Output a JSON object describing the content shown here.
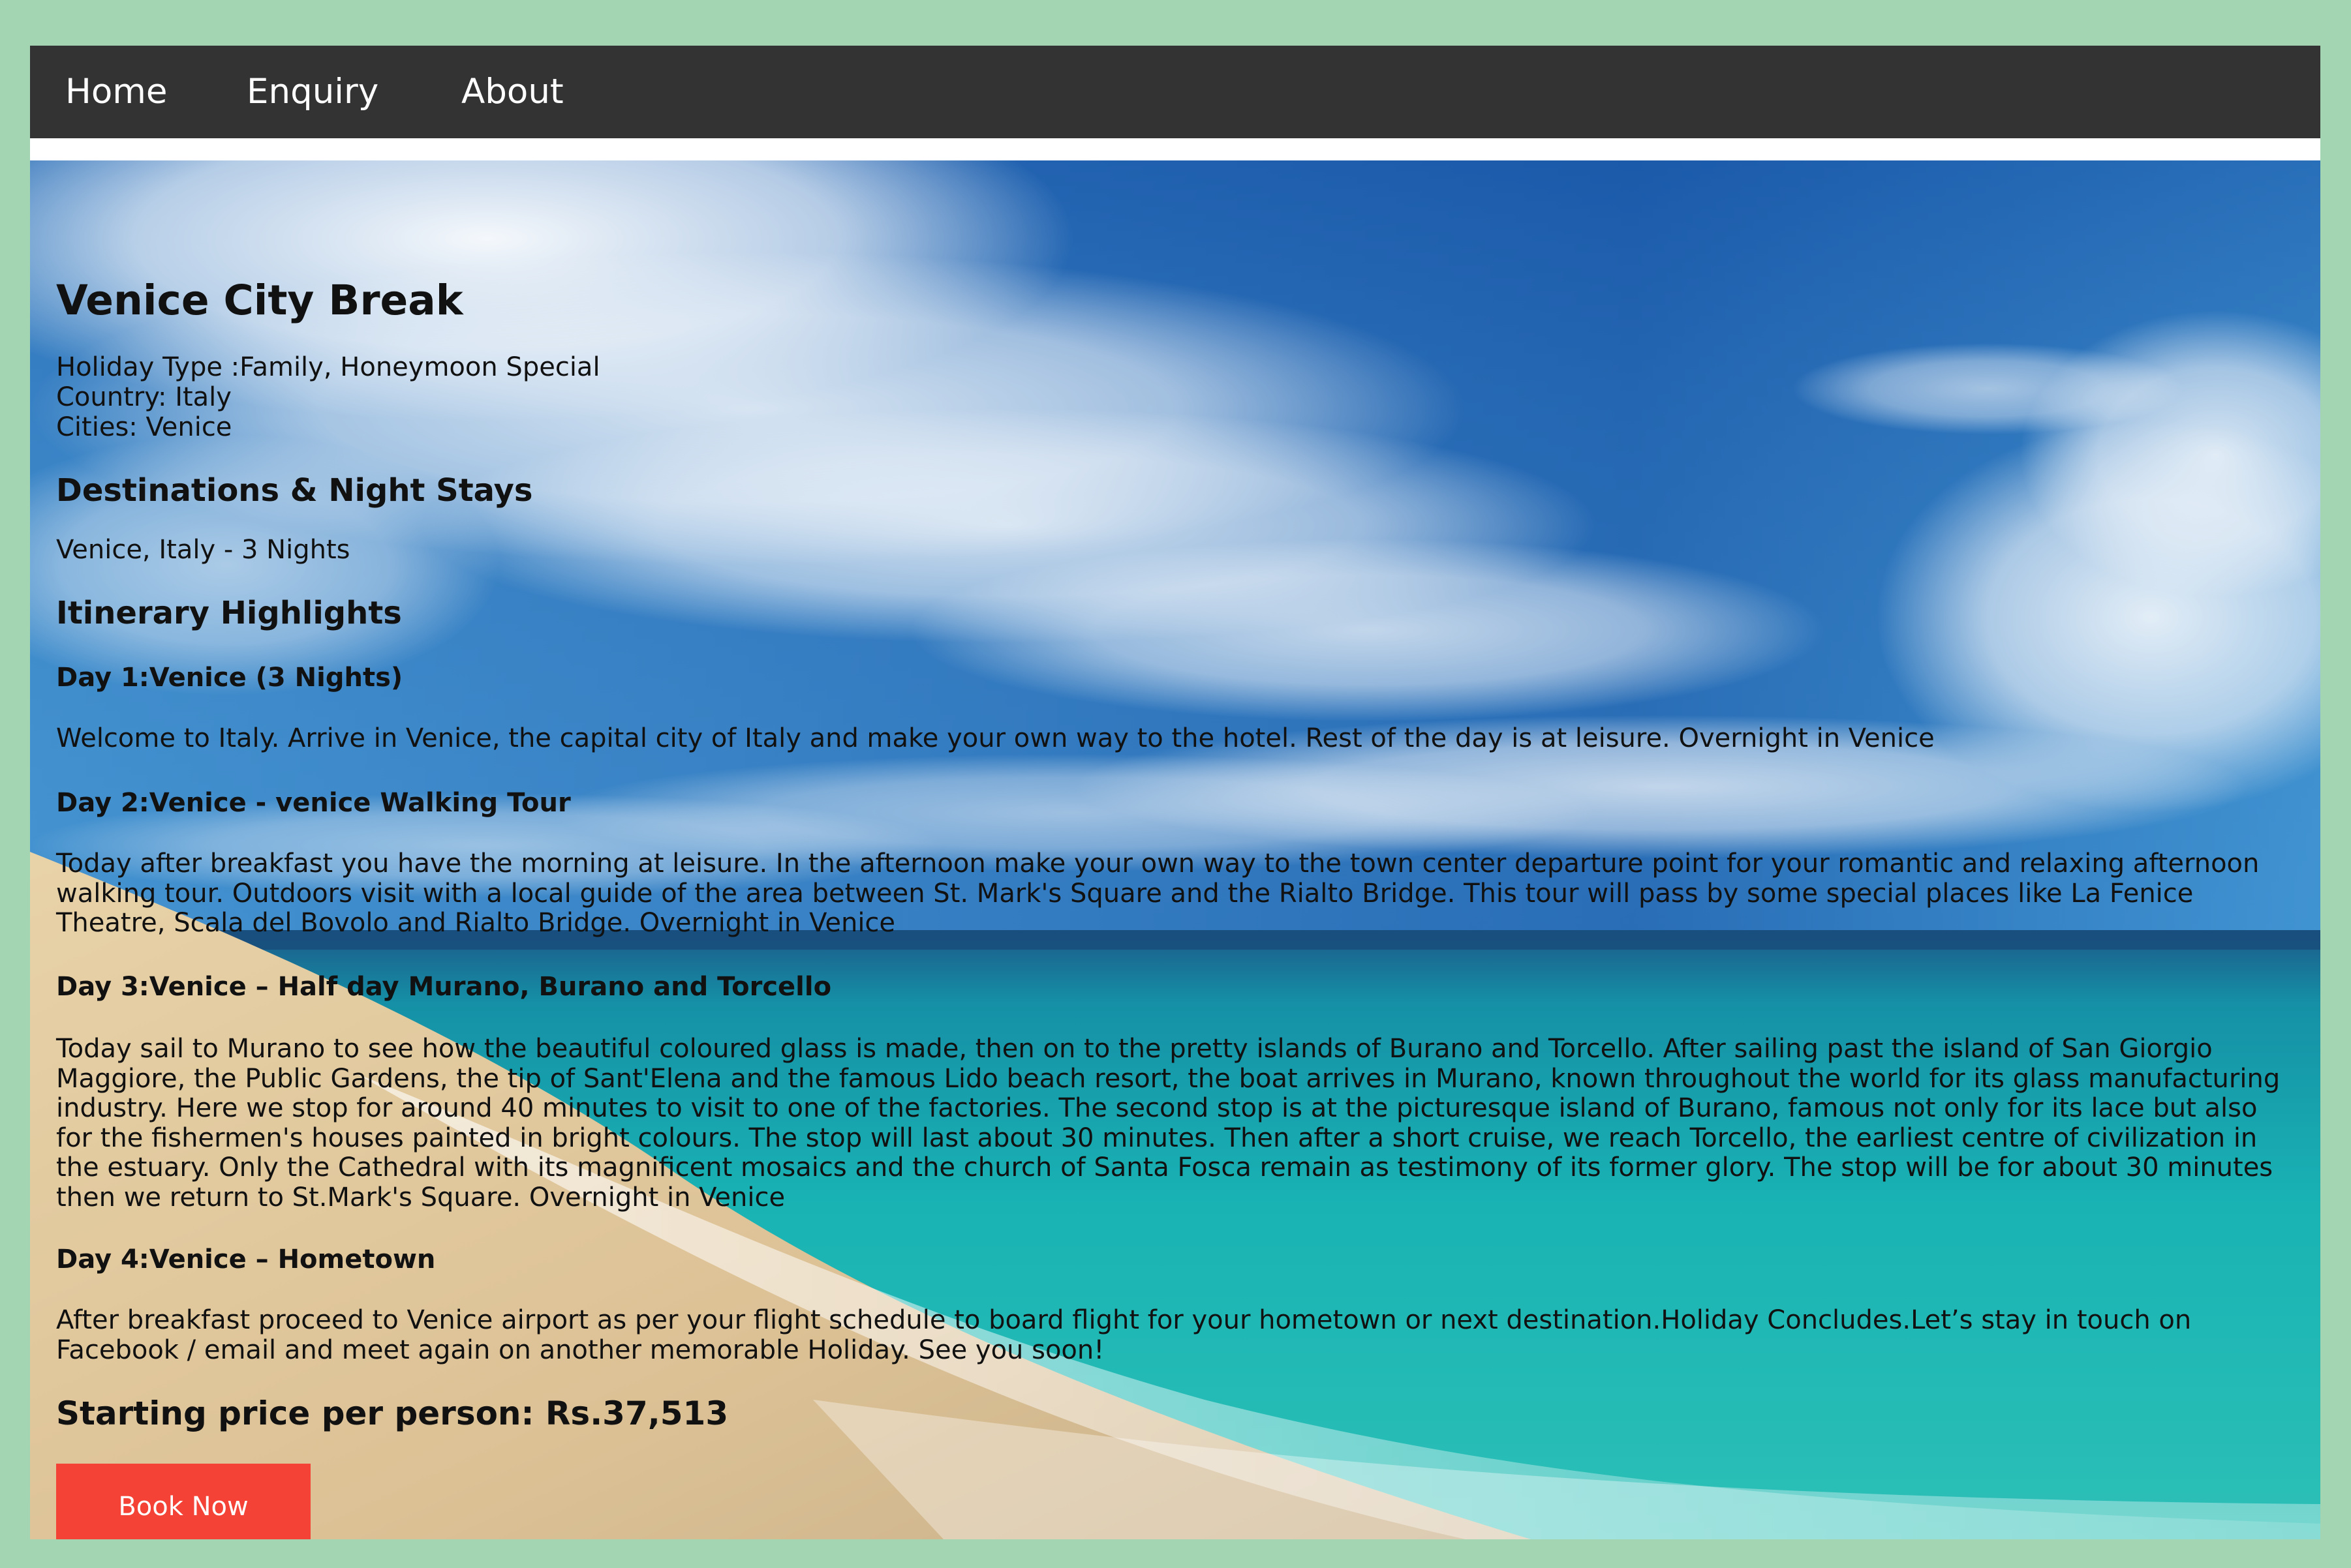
{
  "nav": {
    "home": "Home",
    "enquiry": "Enquiry",
    "about": "About"
  },
  "colors": {
    "page_border": "#a3d5b3",
    "navbar": "#333333",
    "book_button": "#f44336"
  },
  "tour": {
    "title": "Venice City Break",
    "holiday_type": "Holiday Type :Family, Honeymoon Special",
    "country": "Country: Italy",
    "cities": "Cities: Venice",
    "destinations_heading": "Destinations & Night Stays",
    "destinations": "Venice, Italy - 3 Nights",
    "itinerary_heading": "Itinerary Highlights",
    "days": [
      {
        "title": "Day 1:Venice (3 Nights)",
        "text": "Welcome to Italy. Arrive in Venice, the capital city of Italy and make your own way to the hotel. Rest of the day is at leisure. Overnight in Venice"
      },
      {
        "title": "Day 2:Venice - venice Walking Tour",
        "text": "Today after breakfast you have the morning at leisure. In the afternoon make your own way to the town center departure point for your romantic and relaxing afternoon walking tour. Outdoors visit with a local guide of the area between St. Mark's Square and the Rialto Bridge. This tour will pass by some special places like La Fenice Theatre, Scala del Bovolo and Rialto Bridge. Overnight in Venice"
      },
      {
        "title": "Day 3:Venice – Half day Murano, Burano and Torcello",
        "text": "Today sail to Murano to see how the beautiful coloured glass is made, then on to the pretty islands of Burano and Torcello. After sailing past the island of San Giorgio Maggiore, the Public Gardens, the tip of Sant'Elena and the famous Lido beach resort, the boat arrives in Murano, known throughout the world for its glass manufacturing industry. Here we stop for around 40 minutes to visit to one of the factories. The second stop is at the picturesque island of Burano, famous not only for its lace but also for the fishermen's houses painted in bright colours. The stop will last about 30 minutes. Then after a short cruise, we reach Torcello, the earliest centre of civilization in the estuary. Only the Cathedral with its magnificent mosaics and the church of Santa Fosca remain as testimony of its former glory. The stop will be for about 30 minutes then we return to St.Mark's Square. Overnight in Venice"
      },
      {
        "title": "Day 4:Venice – Hometown",
        "text": "After breakfast proceed to Venice airport as per your flight schedule to board flight for your hometown or next destination.Holiday Concludes.Let’s stay in touch on Facebook / email and meet again on another memorable Holiday. See you soon!"
      }
    ],
    "price": "Starting price per person: Rs.37,513",
    "book_button": "Book Now"
  }
}
